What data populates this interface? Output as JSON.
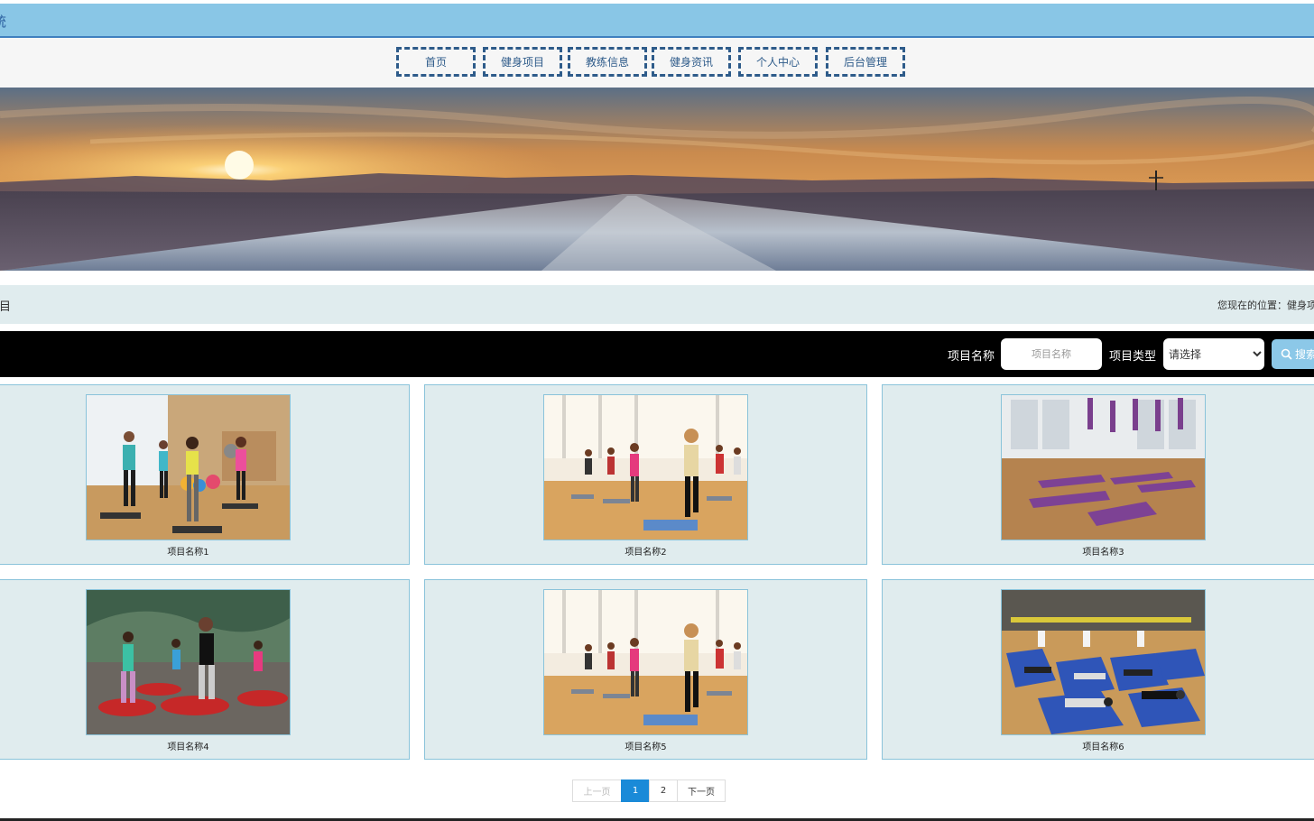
{
  "header": {
    "title": "统"
  },
  "nav": {
    "items": [
      "首页",
      "健身项目",
      "教练信息",
      "健身资讯",
      "个人中心",
      "后台管理"
    ]
  },
  "banner": {
    "slides": 3,
    "active_slide": 1
  },
  "breadcrumb": {
    "section_title": "项目",
    "location_prefix": "您现在的位置：",
    "location_current": "健身项"
  },
  "search": {
    "name_label": "项目名称",
    "name_placeholder": "项目名称",
    "type_label": "项目类型",
    "type_selected": "请选择",
    "button_label": "搜索"
  },
  "items": [
    {
      "name": "项目名称1",
      "scene": "step-aerobics"
    },
    {
      "name": "项目名称2",
      "scene": "step-class"
    },
    {
      "name": "项目名称3",
      "scene": "yoga-studio"
    },
    {
      "name": "项目名称4",
      "scene": "trampoline"
    },
    {
      "name": "项目名称5",
      "scene": "step-class"
    },
    {
      "name": "项目名称6",
      "scene": "plank-hall"
    }
  ],
  "pagination": {
    "prev": "上一页",
    "pages": [
      "1",
      "2"
    ],
    "current": "1",
    "next": "下一页"
  },
  "colors": {
    "accent": "#1a8ad8",
    "topbar": "#89c6e6",
    "card_bg": "#e0ecee",
    "nav_border": "#2e5b8a"
  }
}
